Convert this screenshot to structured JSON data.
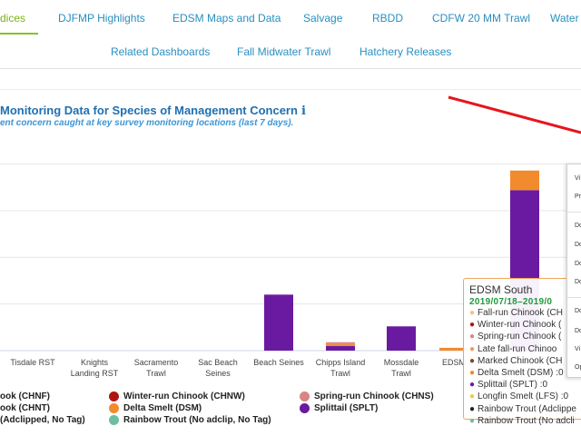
{
  "nav": {
    "row1": [
      {
        "label": "dices",
        "active": true
      },
      {
        "label": "DJFMP Highlights"
      },
      {
        "label": "EDSM Maps and Data"
      },
      {
        "label": "Salvage"
      },
      {
        "label": "RBDD"
      },
      {
        "label": "CDFW 20 MM Trawl"
      },
      {
        "label": "Water"
      }
    ],
    "row2": [
      {
        "label": "Related Dashboards"
      },
      {
        "label": "Fall Midwater Trawl"
      },
      {
        "label": "Hatchery Releases"
      }
    ]
  },
  "chart_header": {
    "title": "Monitoring Data for Species of Management Concern",
    "info_icon": "i",
    "subtitle": "ent concern caught at key survey monitoring locations (last 7 days)."
  },
  "colors": {
    "splittail": "#6a1aa0",
    "delta_smelt": "#f28a2e",
    "winter_run": "#b01212",
    "spring_run": "#d98585",
    "rainbow_no_adclip": "#6dbfa0",
    "arrow": "#e8141c",
    "tooltip_border": "#f2a55a",
    "nav_active": "#7ab317",
    "nav_link": "#2a8fc0"
  },
  "chart_data": {
    "type": "bar",
    "stacked": true,
    "categories": [
      "Tisdale RST",
      "Knights Landing RST",
      "Sacramento Trawl",
      "Sac Beach Seines",
      "Beach Seines",
      "Chipps Island Trawl",
      "Mossdale Trawl",
      "EDSM",
      "EDSM South"
    ],
    "category_labels": [
      [
        "Tisdale RST"
      ],
      [
        "Knights",
        "Landing RST"
      ],
      [
        "Sacramento",
        "Trawl"
      ],
      [
        "Sac Beach",
        "Seines"
      ],
      [
        "Beach Seines"
      ],
      [
        "Chipps Island",
        "Trawl"
      ],
      [
        "Mossdale",
        "Trawl"
      ],
      [
        "EDSM"
      ],
      [
        ""
      ]
    ],
    "series": [
      {
        "name": "Splittail (SPLT)",
        "color": "#6a1aa0",
        "values": [
          0,
          0,
          0,
          0,
          60,
          5,
          26,
          0,
          172
        ]
      },
      {
        "name": "Delta Smelt (DSM)",
        "color": "#f28a2e",
        "values": [
          0,
          0,
          0,
          0,
          0,
          2,
          0,
          3,
          21
        ]
      },
      {
        "name": "Spring-run Chinook (CHNS)",
        "color": "#d98585",
        "values": [
          0,
          0,
          0,
          0,
          0,
          2,
          0,
          0,
          0
        ]
      }
    ],
    "ylim": [
      0,
      220
    ],
    "grid": true,
    "legend_placement": "bottom"
  },
  "legend": [
    {
      "label": "ook (CHNF)",
      "color": "#f5c08a"
    },
    {
      "label": "Winter-run Chinook (CHNW)",
      "color": "#b01212"
    },
    {
      "label": "Spring-run Chinook (CHNS)",
      "color": "#d98585"
    },
    {
      "label": "ook (CHNT)",
      "color": "#e6a05a"
    },
    {
      "label": "Delta Smelt (DSM)",
      "color": "#f28a2e"
    },
    {
      "label": "Splittail (SPLT)",
      "color": "#6a1aa0"
    },
    {
      "label": "(Adclipped, No Tag)",
      "color": ""
    },
    {
      "label": "Rainbow Trout (No adclip, No Tag)",
      "color": "#6dbfa0"
    }
  ],
  "tooltip": {
    "title": "EDSM South",
    "date": "2019/07/18–2019/0",
    "rows": [
      {
        "label": "Fall-run Chinook (CH",
        "color": "#f5c08a"
      },
      {
        "label": "Winter-run Chinook (",
        "color": "#b01212"
      },
      {
        "label": "Spring-run Chinook (",
        "color": "#d98585"
      },
      {
        "label": "Late fall-run Chinoo",
        "color": "#e6a05a"
      },
      {
        "label": "Marked Chinook (CH",
        "color": "#7a4a2a"
      },
      {
        "label": "Delta Smelt (DSM) :0",
        "color": "#f28a2e"
      },
      {
        "label": "Splittail (SPLT) :0",
        "color": "#6a1aa0"
      },
      {
        "label": "Longfin Smelt (LFS) :0",
        "color": "#f5c842"
      },
      {
        "label": "Rainbow Trout (Adclippe",
        "color": "#222222"
      },
      {
        "label": "Rainbow Trout (No adcli",
        "color": "#6dbfa0"
      }
    ]
  },
  "context_menu": {
    "items": [
      "Vi",
      "Pr",
      "Do",
      "Do",
      "Do",
      "Do",
      "Do",
      "Do",
      "Vi",
      "Op"
    ]
  }
}
